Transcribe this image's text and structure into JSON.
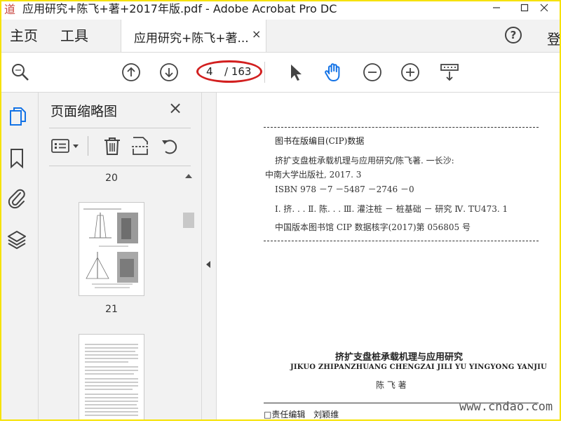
{
  "app": {
    "logo_text": "道",
    "window_title": "应用研究+陈飞+著+2017年版.pdf - Adobe Acrobat Pro DC"
  },
  "menu": {
    "home": "主页",
    "tools": "工具",
    "doc_tab": "应用研究+陈飞+著...",
    "tab_close": "×",
    "login": "登"
  },
  "toolbar": {
    "current_page": "4",
    "total_pages": "/ 163"
  },
  "panel": {
    "title": "页面缩略图",
    "close": "×",
    "page_numbers": [
      "20",
      "21"
    ]
  },
  "document": {
    "cip_heading": "图书在版编目(CIP)数据",
    "cip_lines": [
      "挤扩支盘桩承载机理与应用研究/陈飞著. 一长沙:",
      "中南大学出版社, 2017. 3",
      "ISBN 978 －7 －5487 －2746 －0",
      "Ⅰ. 挤. . .  Ⅱ. 陈. . .  Ⅲ. 灌注桩 － 桩基础 － 研究  Ⅳ. TU473. 1",
      "中国版本图书馆 CIP 数据核字(2017)第 056805 号"
    ],
    "book_title": "挤扩支盘桩承载机理与应用研究",
    "book_pinyin": "JIKUO ZHIPANZHUANG CHENGZAI JILI YU YINGYONG YANJIU",
    "author": "陈 飞 著",
    "editor_label": "□责任编辑",
    "editor_name": "刘颖维",
    "watermark": "www.cndao.com"
  },
  "colors": {
    "accent_blue": "#1473e6",
    "annotation_red": "#d21f1f",
    "frame_yellow": "#f6e200"
  }
}
